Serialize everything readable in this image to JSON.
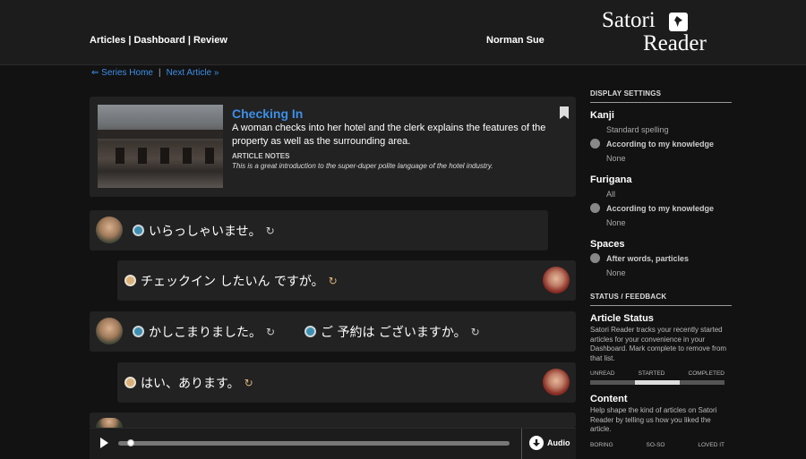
{
  "header": {
    "nav": [
      {
        "label": "Articles"
      },
      {
        "label": "Dashboard"
      },
      {
        "label": "Review"
      }
    ],
    "nav_separator": "|",
    "user_name": "Norman Sue",
    "logo_line1": "Satori",
    "logo_line2": "Reader"
  },
  "breadcrumbs": {
    "series_home": "⇐ Series Home",
    "separator": "|",
    "next_article": "Next Article »"
  },
  "article": {
    "title": "Checking In",
    "description": "A woman checks into her hotel and the clerk explains the features of the property as well as the surrounding area.",
    "notes_label": "ARTICLE NOTES",
    "notes_text": "This is a great introduction to the super-duper polite language of the hotel industry."
  },
  "lines": [
    {
      "speaker": "male",
      "segments": [
        {
          "text": "いらっしゃいませ。"
        }
      ]
    },
    {
      "speaker": "female",
      "segments": [
        {
          "text": "チェックイン したいん ですが。"
        }
      ]
    },
    {
      "speaker": "male",
      "segments": [
        {
          "text": "かしこまりました。"
        },
        {
          "text": "ご 予約は ございますか。"
        }
      ]
    },
    {
      "speaker": "female",
      "segments": [
        {
          "text": "はい、あります。"
        }
      ]
    }
  ],
  "player": {
    "audio_label": "Audio",
    "progress": 0.03
  },
  "sidebar": {
    "display_settings_heading": "DISPLAY SETTINGS",
    "kanji": {
      "label": "Kanji",
      "options": [
        "Standard spelling",
        "According to my knowledge",
        "None"
      ],
      "selected": 1
    },
    "furigana": {
      "label": "Furigana",
      "options": [
        "All",
        "According to my knowledge",
        "None"
      ],
      "selected": 1
    },
    "spaces": {
      "label": "Spaces",
      "options": [
        "After words, particles",
        "None"
      ],
      "selected": 0
    },
    "status_heading": "STATUS / FEEDBACK",
    "article_status": {
      "title": "Article Status",
      "text": "Satori Reader tracks your recently started articles for your convenience in your Dashboard. Mark complete to remove from that list.",
      "labels": [
        "UNREAD",
        "STARTED",
        "COMPLETED"
      ],
      "active_index": 1
    },
    "content": {
      "title": "Content",
      "text": "Help shape the kind of articles on Satori Reader by telling us how you liked the article.",
      "labels": [
        "BORING",
        "SO-SO",
        "LOVED IT"
      ]
    }
  },
  "colors": {
    "link": "#3d8fe6",
    "background": "#121212",
    "card": "#222222",
    "male_play": "#3d8fb0",
    "female_play": "#d9b07a"
  },
  "icons": {
    "play_line": "play-circle-icon",
    "loop": "loop-icon",
    "bookmark": "bookmark-icon",
    "download": "download-icon"
  }
}
